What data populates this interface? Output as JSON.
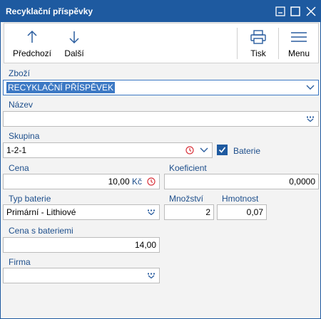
{
  "window": {
    "title": "Recyklační příspěvky"
  },
  "toolbar": {
    "previous_label": "Předchozí",
    "next_label": "Další",
    "print_label": "Tisk",
    "menu_label": "Menu"
  },
  "form": {
    "zbozi": {
      "label": "Zboží",
      "value": "RECYKLAČNÍ PŘÍSPĚVEK"
    },
    "nazev": {
      "label": "Název",
      "value": ""
    },
    "skupina": {
      "label": "Skupina",
      "value": "1-2-1"
    },
    "baterie": {
      "label": "Baterie",
      "checked": true
    },
    "cena": {
      "label": "Cena",
      "value": "10,00",
      "currency": "Kč"
    },
    "koeficient": {
      "label": "Koeficient",
      "value": "0,0000"
    },
    "typ_baterie": {
      "label": "Typ baterie",
      "value": "Primární - Lithiové"
    },
    "mnozstvi": {
      "label": "Množství",
      "value": "2"
    },
    "hmotnost": {
      "label": "Hmotnost",
      "value": "0,07"
    },
    "cena_s_bateriemi": {
      "label": "Cena s bateriemi",
      "value": "14,00"
    },
    "firma": {
      "label": "Firma",
      "value": ""
    }
  },
  "colors": {
    "title_bar": "#1e5aa0",
    "label": "#1e4f8c",
    "selection": "#3d79c4",
    "clock_icon": "#d9363e"
  },
  "icons": [
    "minimize-icon",
    "maximize-icon",
    "close-icon",
    "arrow-up-icon",
    "arrow-down-icon",
    "printer-icon",
    "hamburger-menu-icon",
    "chevron-down-icon",
    "clock-icon",
    "lookup-icon",
    "checkmark-icon"
  ]
}
